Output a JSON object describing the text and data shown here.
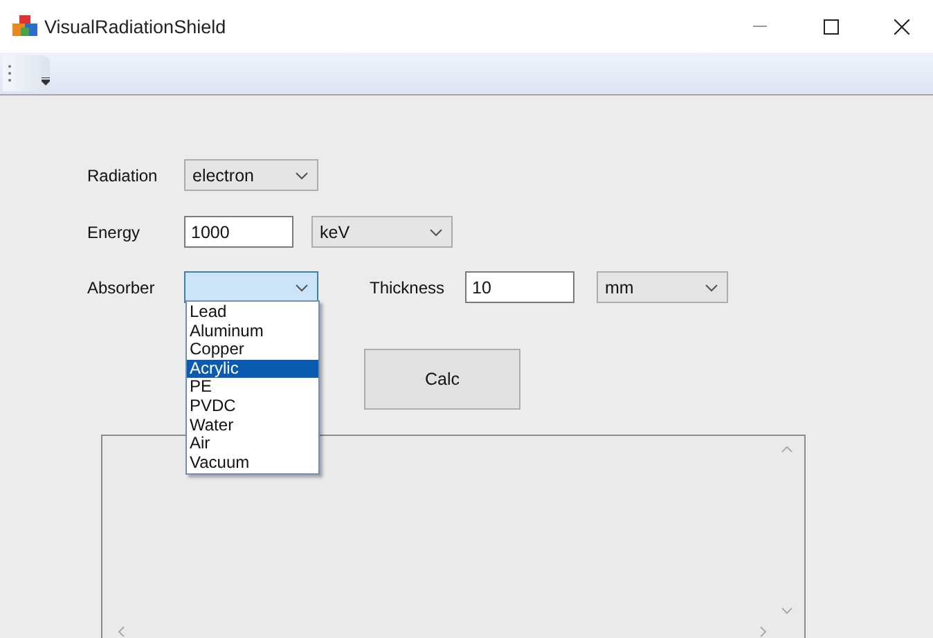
{
  "window": {
    "title": "VisualRadiationShield"
  },
  "form": {
    "radiation": {
      "label": "Radiation",
      "value": "electron"
    },
    "energy": {
      "label": "Energy",
      "value": "1000",
      "unit": "keV"
    },
    "absorber": {
      "label": "Absorber",
      "expanded": true,
      "options": [
        {
          "label": "Lead",
          "selected": false
        },
        {
          "label": "Aluminum",
          "selected": false
        },
        {
          "label": "Copper",
          "selected": false
        },
        {
          "label": "Acrylic",
          "selected": true
        },
        {
          "label": "PE",
          "selected": false
        },
        {
          "label": "PVDC",
          "selected": false
        },
        {
          "label": "Water",
          "selected": false
        },
        {
          "label": "Air",
          "selected": false
        },
        {
          "label": "Vacuum",
          "selected": false
        }
      ]
    },
    "thickness": {
      "label": "Thickness",
      "value": "10",
      "unit": "mm"
    },
    "calc_button": {
      "label": "Calc"
    }
  }
}
